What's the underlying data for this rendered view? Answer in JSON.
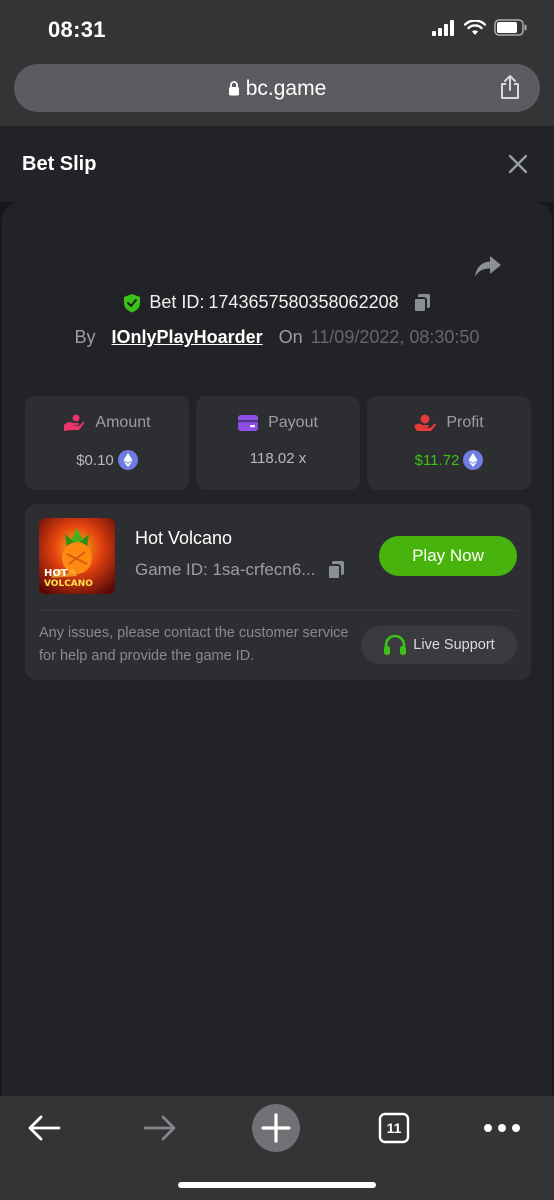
{
  "status_bar": {
    "time": "08:31"
  },
  "browser": {
    "url": "bc.game"
  },
  "slip": {
    "title": "Bet Slip",
    "bet_id_label": "Bet ID:",
    "bet_id": "1743657580358062208",
    "by_label": "By",
    "username": "IOnlyPlayHoarder",
    "on_label": "On",
    "datetime": "11/09/2022, 08:30:50"
  },
  "stats": [
    {
      "label": "Amount",
      "value": "$0.10",
      "icon": "amount-icon",
      "color": "#e8336b"
    },
    {
      "label": "Payout",
      "value": "118.02 x",
      "icon": "wallet-icon",
      "color": "#8d4fe8"
    },
    {
      "label": "Profit",
      "value": "$11.72",
      "icon": "profit-icon",
      "color": "#e83a3a"
    }
  ],
  "game": {
    "name": "Hot Volcano",
    "game_id": "Game ID: 1sa-crfecn6...",
    "play_label": "Play Now",
    "thumb_text": [
      "HOT",
      "VOLCANO"
    ],
    "help_text": "Any issues, please contact the customer service for help and provide the game ID.",
    "support_label": "Live Support"
  },
  "toolbar": {
    "tabs_count": "11"
  },
  "colors": {
    "accent_green": "#47b30c",
    "profit_green": "#3bc117",
    "eth_blue": "#6f7ce3"
  }
}
